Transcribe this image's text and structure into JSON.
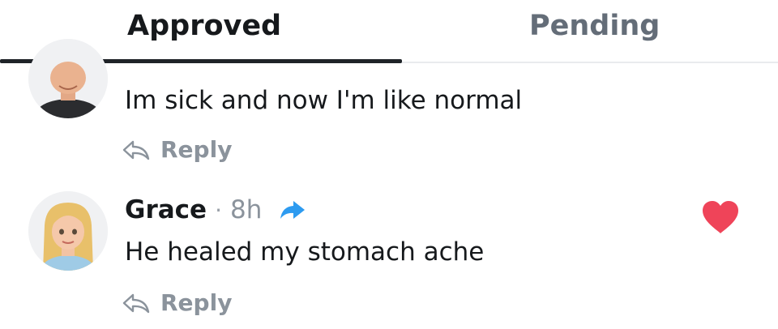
{
  "tabs": {
    "approved": "Approved",
    "pending": "Pending"
  },
  "comments": [
    {
      "text": "Im sick and now I'm like normal",
      "reply_label": "Reply"
    },
    {
      "author": "Grace",
      "separator": "·",
      "time": "8h",
      "text": "He healed my stomach ache",
      "reply_label": "Reply",
      "liked": true
    }
  ],
  "colors": {
    "heart": "#ef4459",
    "share_arrow": "#2d9bf0",
    "active_tab": "#16191c",
    "inactive_tab": "#646d78",
    "meta_text": "#8b939c"
  }
}
